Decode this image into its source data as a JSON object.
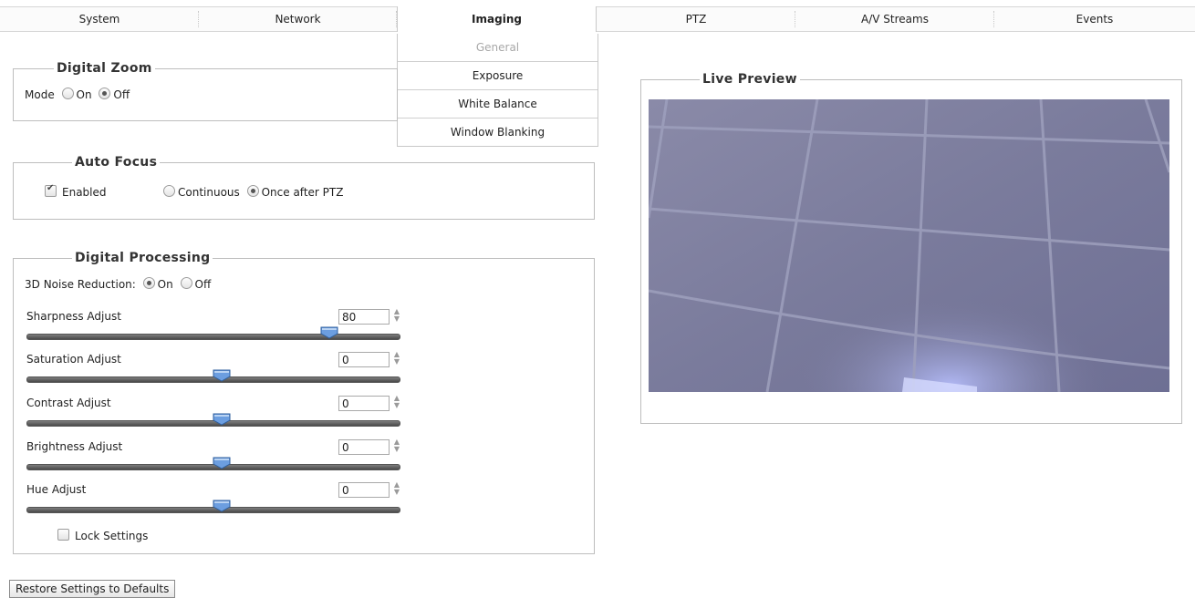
{
  "tabs": [
    {
      "label": "System"
    },
    {
      "label": "Network"
    },
    {
      "label": "Imaging",
      "active": true
    },
    {
      "label": "PTZ"
    },
    {
      "label": "A/V Streams"
    },
    {
      "label": "Events"
    }
  ],
  "submenu": [
    {
      "label": "General",
      "disabled": true
    },
    {
      "label": "Exposure"
    },
    {
      "label": "White Balance"
    },
    {
      "label": "Window Blanking"
    }
  ],
  "digital_zoom": {
    "legend": "Digital Zoom",
    "mode_label": "Mode",
    "on_label": "On",
    "off_label": "Off",
    "selected": "Off"
  },
  "auto_focus": {
    "legend": "Auto Focus",
    "enabled_label": "Enabled",
    "enabled": true,
    "continuous_label": "Continuous",
    "once_label": "Once after PTZ",
    "selected": "Once after PTZ"
  },
  "digital_processing": {
    "legend": "Digital Processing",
    "nr_label": "3D Noise Reduction:",
    "nr_on_label": "On",
    "nr_off_label": "Off",
    "nr_selected": "On",
    "sliders": [
      {
        "label": "Sharpness Adjust",
        "value": "80"
      },
      {
        "label": "Saturation Adjust",
        "value": "0"
      },
      {
        "label": "Contrast Adjust",
        "value": "0"
      },
      {
        "label": "Brightness Adjust",
        "value": "0"
      },
      {
        "label": "Hue Adjust",
        "value": "0"
      }
    ],
    "lock_label": "Lock Settings",
    "lock_checked": false
  },
  "live_preview": {
    "legend": "Live Preview"
  },
  "restore_button": "Restore Settings to Defaults",
  "colors": {
    "preview_bg": "#7f7f9e",
    "slider_handle": "#5b8fd6"
  },
  "icons": {
    "spin": "up-down-arrows-icon",
    "handle": "slider-handle-icon"
  }
}
